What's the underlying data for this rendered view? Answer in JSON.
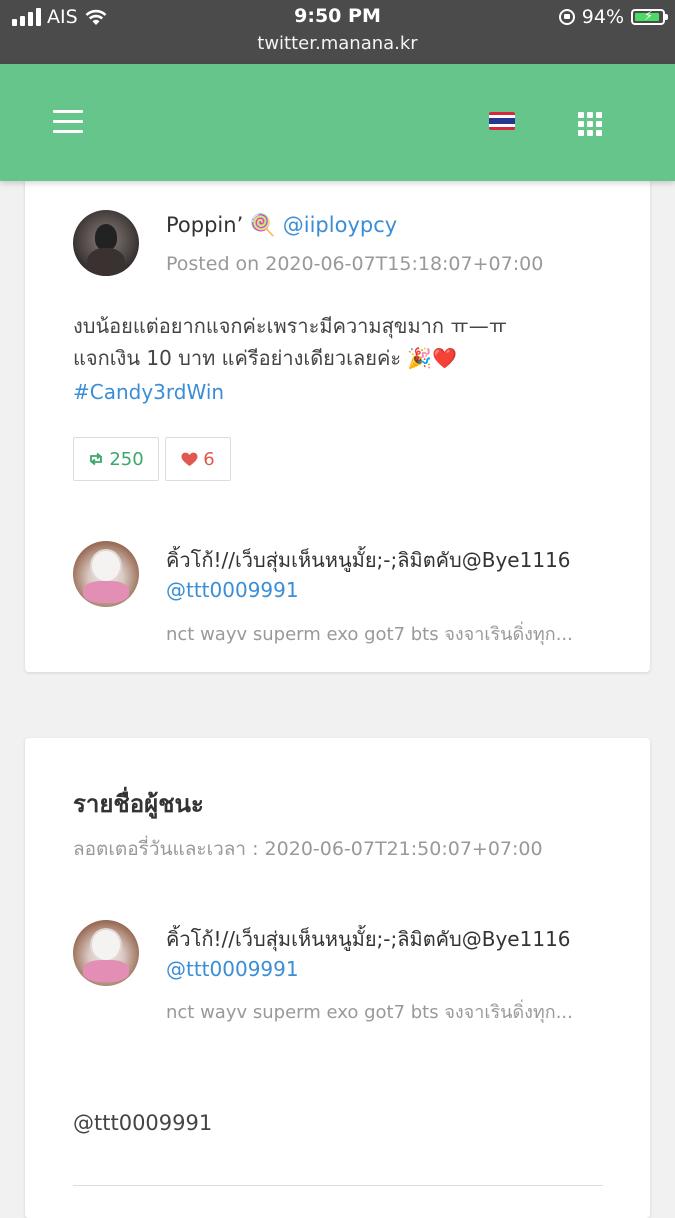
{
  "status_bar": {
    "carrier": "AIS",
    "time": "9:50 PM",
    "url": "twitter.manana.kr",
    "battery_percent": "94%",
    "battery_level": 0.94,
    "charging": true
  },
  "header": {
    "menu_icon": "hamburger-menu-icon",
    "language_icon": "thailand-flag-icon",
    "apps_icon": "grid-apps-icon",
    "color": "#66c58a"
  },
  "tweet": {
    "author_name": "Poppin’ 🍭",
    "author_handle": "@iiploypcy",
    "posted": "Posted on 2020-06-07T15:18:07+07:00",
    "text_line1": "งบน้อยแต่อยากแจกค่ะเพราะมีความสุขมาก ㅠ—ㅠ",
    "text_line2": "แจกเงิน 10 บาท แค่รีอย่างเดียวเลยค่ะ 🎉❤️",
    "hashtag": "#Candy3rdWin",
    "retweets": "250",
    "likes": "6"
  },
  "participant": {
    "name": "คิ้วโก้!//เว็บสุ่มเห็นหนูมั้ย;-;ลิมิตคับ@Bye1116",
    "handle": "@ttt0009991",
    "bio": "nct wayv superm exo got7 bts จงจาเรินดิ่งทุก..."
  },
  "winners": {
    "title": "รายชื่อผู้ชนะ",
    "lottery_time": "ลอตเตอรี่วันและเวลา : 2020-06-07T21:50:07+07:00",
    "winner_name": "คิ้วโก้!//เว็บสุ่มเห็นหนูมั้ย;-;ลิมิตคับ@Bye1116",
    "winner_handle": "@ttt0009991",
    "winner_bio": "nct wayv superm exo got7 bts จงจาเรินดิ่งทุก...",
    "winner_text": "@ttt0009991"
  },
  "colors": {
    "link": "#3b8ed6",
    "retweet": "#3aa86a",
    "like": "#e0584f"
  }
}
